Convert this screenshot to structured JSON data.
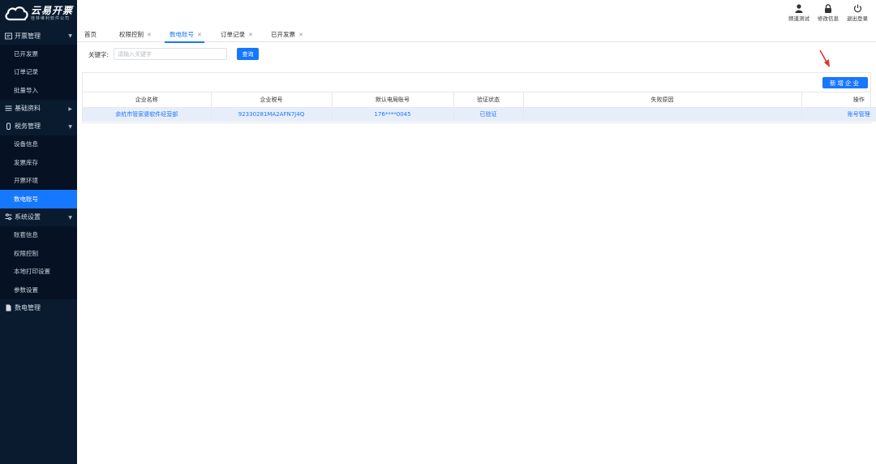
{
  "brand": {
    "name": "云易开票",
    "tagline": "桂林维利软件公司"
  },
  "header_actions": [
    {
      "label": "频道测试",
      "icon": "user-icon"
    },
    {
      "label": "修改信息",
      "icon": "lock-icon"
    },
    {
      "label": "退出登录",
      "icon": "power-icon"
    }
  ],
  "sidebar": {
    "groups": [
      {
        "label": "开票管理",
        "icon": "invoice-icon",
        "items": [
          "已开发票",
          "订单记录",
          "批量导入"
        ]
      },
      {
        "label": "基础资料",
        "icon": "list-icon",
        "items": []
      },
      {
        "label": "税务管理",
        "icon": "tax-icon",
        "items": [
          "设备信息",
          "发票库存",
          "开票环境",
          "数电账号"
        ]
      },
      {
        "label": "系统设置",
        "icon": "settings-icon",
        "items": [
          "账套信息",
          "权限控制",
          "本地打印设置",
          "参数设置"
        ]
      },
      {
        "label": "数电管理",
        "icon": "document-icon",
        "items": []
      }
    ],
    "active_item": "数电账号"
  },
  "tabs": [
    {
      "label": "首页",
      "closable": false
    },
    {
      "label": "权限控制",
      "closable": true
    },
    {
      "label": "数电账号",
      "closable": true,
      "active": true
    },
    {
      "label": "订单记录",
      "closable": true
    },
    {
      "label": "已开发票",
      "closable": true
    }
  ],
  "search": {
    "label": "关键字:",
    "placeholder": "请输入关键字",
    "value": "",
    "button": "查询"
  },
  "toolbar": {
    "add_label": "新增企业"
  },
  "table": {
    "columns": [
      "企业名称",
      "企业税号",
      "默认电局账号",
      "验证状态",
      "失败原因",
      "操作"
    ],
    "rows": [
      [
        "余杭市管家婆软件经营部",
        "92330281MA2AFN7J4Q",
        "176****0045",
        "已验证",
        "",
        "账号管理"
      ]
    ]
  },
  "colors": {
    "accent": "#1677ff",
    "sidebar_bg": "#0a1b30",
    "annotation_arrow": "#e0362c"
  }
}
